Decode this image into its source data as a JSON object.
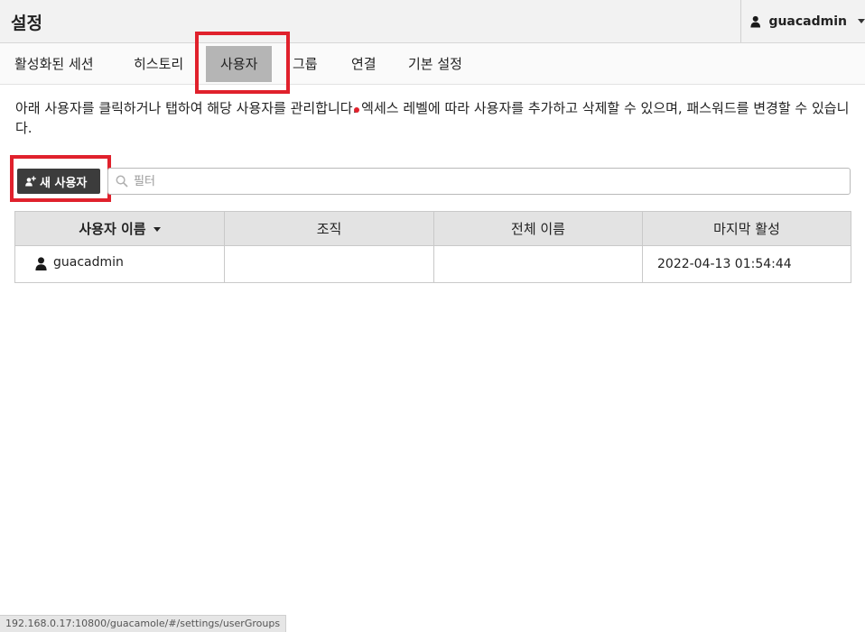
{
  "header": {
    "title": "설정",
    "username": "guacadmin"
  },
  "tabs": [
    {
      "label": "활성화된 세션"
    },
    {
      "label": "히스토리"
    },
    {
      "label": "사용자"
    },
    {
      "label": "그룹"
    },
    {
      "label": "연결"
    },
    {
      "label": "기본 설정"
    }
  ],
  "active_tab": "사용자",
  "description": "아래 사용자를 클릭하거나 탭하여 해당 사용자를 관리합니다. 엑세스 레벨에 따라 사용자를 추가하고 삭제할 수 있으며, 패스워드를 변경할 수 있습니다.",
  "toolbar": {
    "new_user_label": "새 사용자",
    "filter_placeholder": "필터",
    "filter_value": ""
  },
  "table": {
    "columns": [
      "사용자 이름",
      "조직",
      "전체 이름",
      "마지막 활성"
    ],
    "sorted_column": "사용자 이름",
    "rows": [
      {
        "username": "guacadmin",
        "organization": "",
        "full_name": "",
        "last_active": "2022-04-13 01:54:44"
      }
    ]
  },
  "status_bar": {
    "url": "192.168.0.17:10800/guacamole/#/settings/userGroups"
  },
  "colors": {
    "highlight": "#e0212c",
    "active_tab": "#b5b5b5",
    "button_bg": "#3c3c3c"
  },
  "icons": {
    "user_menu": "user-icon",
    "user_menu_caret": "caret-down-icon",
    "new_user": "add-user-icon",
    "filter": "search-icon",
    "row_user": "user-icon",
    "sort": "sort-desc-icon"
  }
}
